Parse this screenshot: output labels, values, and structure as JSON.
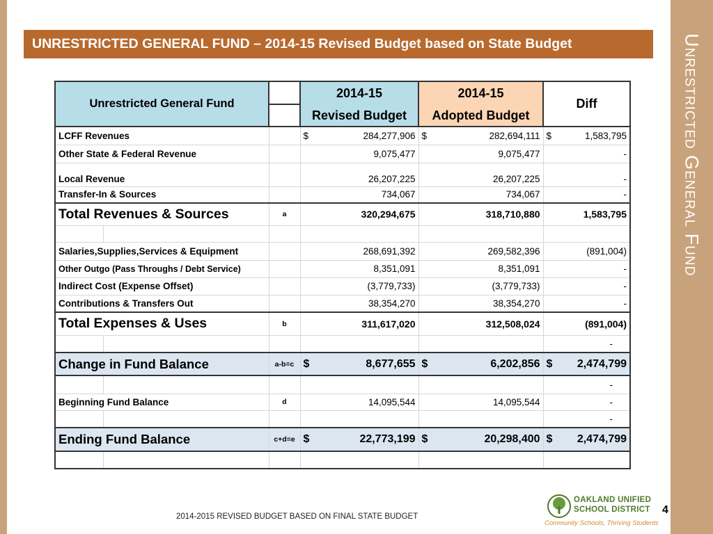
{
  "title": "UNRESTRICTED GENERAL FUND – 2014-15 Revised Budget based on State Budget",
  "side_title": "Unrestricted General Fund",
  "table": {
    "header_label": "Unrestricted General Fund",
    "col_revised_line1": "2014-15",
    "col_revised_line2": "Revised Budget",
    "col_adopted_line1": "2014-15",
    "col_adopted_line2": "Adopted Budget",
    "col_diff": "Diff",
    "rows": [
      {
        "label": "LCFF Revenues",
        "ref": "",
        "revised_cur": "$",
        "revised": "284,277,906",
        "adopted_cur": "$",
        "adopted": "282,694,111",
        "diff_cur": "$",
        "diff": "1,583,795"
      },
      {
        "label": "Other State & Federal Revenue",
        "ref": "",
        "revised": "9,075,477",
        "adopted": "9,075,477",
        "diff": "-"
      },
      {
        "label": "Local Revenue",
        "ref": "",
        "revised": "26,207,225",
        "adopted": "26,207,225",
        "diff": "-"
      },
      {
        "label": "Transfer-In & Sources",
        "ref": "",
        "revised": "734,067",
        "adopted": "734,067",
        "diff": "-"
      },
      {
        "label": "Total Revenues & Sources",
        "ref": "a",
        "revised": "320,294,675",
        "adopted": "318,710,880",
        "diff": "1,583,795"
      },
      {
        "label": "Salaries,Supplies,Services & Equipment",
        "ref": "",
        "revised": "268,691,392",
        "adopted": "269,582,396",
        "diff": "(891,004)"
      },
      {
        "label": "Other Outgo (Pass Throughs / Debt Service)",
        "ref": "",
        "revised": "8,351,091",
        "adopted": "8,351,091",
        "diff": "-"
      },
      {
        "label": "Indirect Cost (Expense Offset)",
        "ref": "",
        "revised": "(3,779,733)",
        "adopted": "(3,779,733)",
        "diff": "-"
      },
      {
        "label": "Contributions & Transfers Out",
        "ref": "",
        "revised": "38,354,270",
        "adopted": "38,354,270",
        "diff": "-"
      },
      {
        "label": "Total Expenses & Uses",
        "ref": "b",
        "revised": "311,617,020",
        "adopted": "312,508,024",
        "diff": "(891,004)"
      },
      {
        "label": "",
        "ref": "",
        "revised": "",
        "adopted": "",
        "diff": "-"
      },
      {
        "label": "Change in Fund Balance",
        "ref": "a-b=c",
        "revised_cur": "$",
        "revised": "8,677,655",
        "adopted_cur": "$",
        "adopted": "6,202,856",
        "diff_cur": "$",
        "diff": "2,474,799"
      },
      {
        "label": "",
        "ref": "",
        "revised": "",
        "adopted": "",
        "diff": "-"
      },
      {
        "label": "Beginning Fund Balance",
        "ref": "d",
        "revised": "14,095,544",
        "adopted": "14,095,544",
        "diff": "-"
      },
      {
        "label": "",
        "ref": "",
        "revised": "",
        "adopted": "",
        "diff": "-"
      },
      {
        "label": "Ending Fund Balance",
        "ref": "c+d=e",
        "revised_cur": "$",
        "revised": "22,773,199",
        "adopted_cur": "$",
        "adopted": "20,298,400",
        "diff_cur": "$",
        "diff": "2,474,799"
      }
    ]
  },
  "footer": "2014-2015 REVISED BUDGET BASED ON FINAL STATE BUDGET",
  "page_number": "4",
  "logo": {
    "line1": "OAKLAND UNIFIED",
    "line2": "SCHOOL DISTRICT",
    "tagline": "Community Schools, Thriving Students"
  },
  "colors": {
    "title_bar": "#b8692d",
    "side_bar": "#c8a27a",
    "revised_header": "#b7dde8",
    "adopted_header": "#fcd5b4",
    "shaded_row": "#dce6f1",
    "logo_green": "#4d7a2a"
  }
}
